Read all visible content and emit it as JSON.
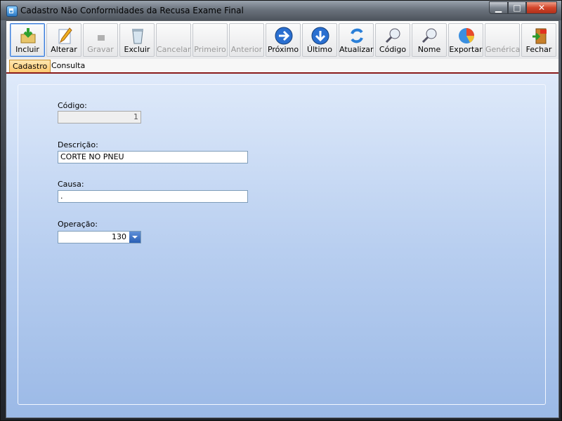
{
  "window": {
    "title": "Cadastro Não Conformidades da Recusa Exame Final"
  },
  "toolbar": [
    {
      "label": "Incluir",
      "icon": "add-icon",
      "enabled": true,
      "active": true
    },
    {
      "label": "Alterar",
      "icon": "edit-icon",
      "enabled": true
    },
    {
      "label": "Gravar",
      "icon": "save-icon",
      "enabled": false
    },
    {
      "label": "Excluir",
      "icon": "delete-icon",
      "enabled": true
    },
    {
      "label": "Cancelar",
      "icon": "cancel-icon",
      "enabled": false
    },
    {
      "label": "Primeiro",
      "icon": "first-icon",
      "enabled": false
    },
    {
      "label": "Anterior",
      "icon": "previous-icon",
      "enabled": false
    },
    {
      "label": "Próximo",
      "icon": "next-arrow-icon",
      "enabled": true
    },
    {
      "label": "Último",
      "icon": "last-arrow-icon",
      "enabled": true
    },
    {
      "label": "Atualizar",
      "icon": "refresh-icon",
      "enabled": true
    },
    {
      "label": "Código",
      "icon": "search-code-icon",
      "enabled": true
    },
    {
      "label": "Nome",
      "icon": "search-name-icon",
      "enabled": true
    },
    {
      "label": "Exportar",
      "icon": "export-chart-icon",
      "enabled": true
    },
    {
      "label": "Genérica",
      "icon": "generic-icon",
      "enabled": false
    },
    {
      "label": "Fechar",
      "icon": "exit-icon",
      "enabled": true
    }
  ],
  "tabs": [
    {
      "label": "Cadastro",
      "selected": true
    },
    {
      "label": "Consulta",
      "selected": false
    }
  ],
  "form": {
    "codigo": {
      "label": "Código:",
      "value": "1"
    },
    "descricao": {
      "label": "Descrição:",
      "value": "CORTE NO PNEU"
    },
    "causa": {
      "label": "Causa:",
      "value": "."
    },
    "operacao": {
      "label": "Operação:",
      "value": "130"
    }
  }
}
